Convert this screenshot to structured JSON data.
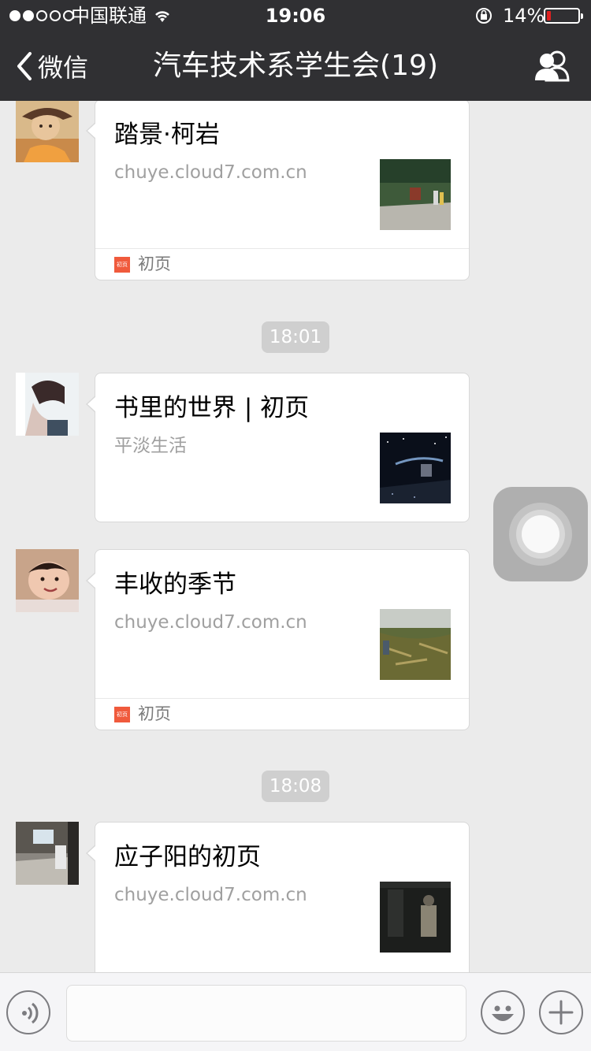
{
  "status_bar": {
    "carrier": "中国联通",
    "time": "19:06",
    "battery_percent_label": "14%",
    "battery_level": 0.14,
    "signal_filled_dots": 2,
    "signal_total_dots": 5,
    "icons": [
      "wifi-icon",
      "orientation-lock-icon",
      "battery-icon"
    ]
  },
  "nav": {
    "back_label": "微信",
    "title": "汽车技术系学生会(19)",
    "right_icon": "group-members-icon"
  },
  "messages": [
    {
      "kind": "card",
      "title": "踏景·柯岩",
      "desc": "chuye.cloud7.com.cn",
      "thumb": "photo-park-path",
      "source_icon_text": "初页",
      "source": "初页",
      "avatar": "avatar-cartoon-cowboy"
    },
    {
      "kind": "time",
      "text": "18:01"
    },
    {
      "kind": "card",
      "title": "书里的世界 | 初页",
      "desc": "平淡生活",
      "thumb": "photo-starry-night",
      "avatar": "avatar-profile-boy"
    },
    {
      "kind": "card",
      "title": "丰收的季节",
      "desc": "chuye.cloud7.com.cn",
      "thumb": "photo-harvest-field",
      "source_icon_text": "初页",
      "source": "初页",
      "avatar": "avatar-smiling-child"
    },
    {
      "kind": "time",
      "text": "18:08"
    },
    {
      "kind": "card",
      "title": "应子阳的初页",
      "desc": "chuye.cloud7.com.cn",
      "thumb": "photo-dark-room",
      "avatar": "avatar-living-room"
    }
  ],
  "input_bar": {
    "message_placeholder": "",
    "icons": [
      "voice-icon",
      "emoji-icon",
      "plus-icon"
    ]
  },
  "colors": {
    "nav_background": "#303033",
    "chat_background": "#ebebeb",
    "timestamp_pill": "#cfcfcf",
    "source_icon": "#f05a3c",
    "battery_low": "#e02020"
  }
}
